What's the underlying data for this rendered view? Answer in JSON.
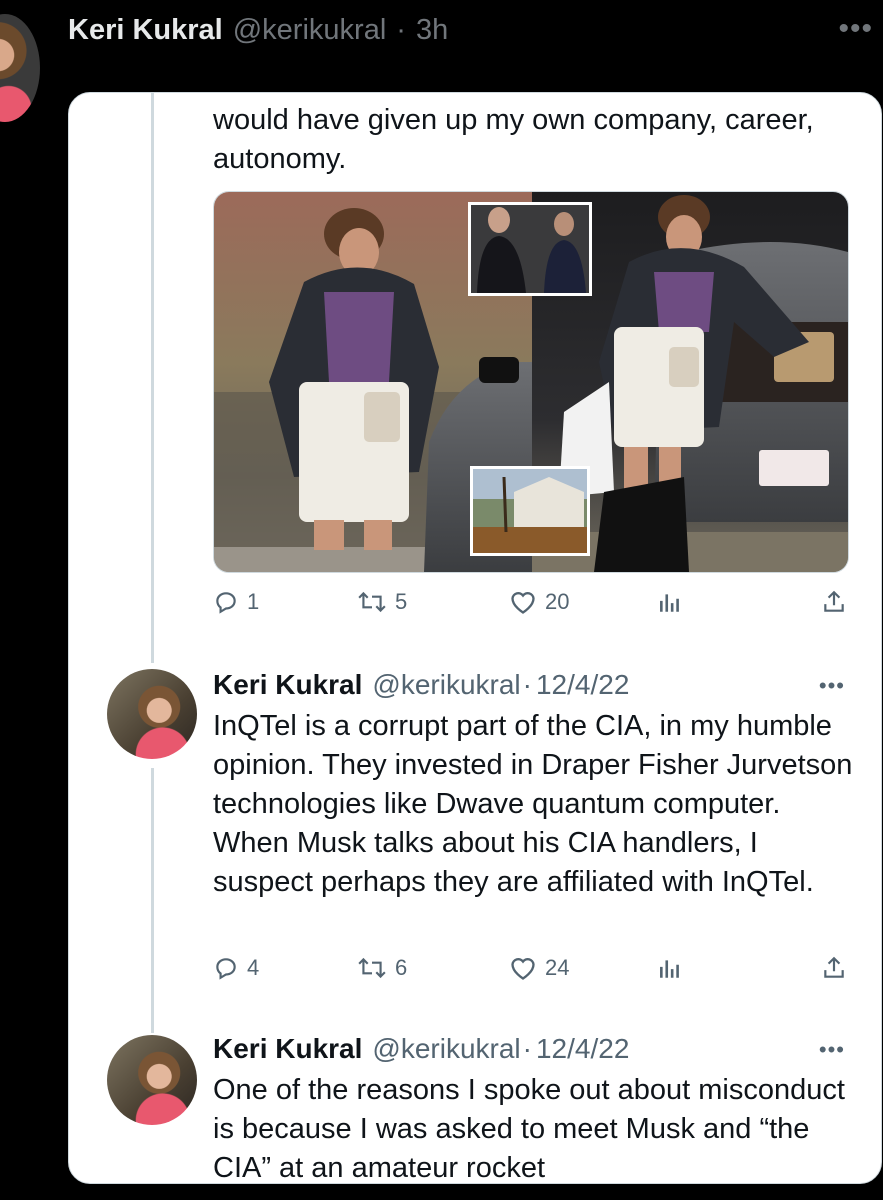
{
  "outer_tweet": {
    "display_name": "Keri Kukral",
    "handle": "@kerikukral",
    "separator": "·",
    "time": "3h",
    "more_label": "•••"
  },
  "quoted_thread": {
    "first_tweet": {
      "text_partial": "would have given up my own company, career, autonomy.",
      "actions": {
        "replies": "1",
        "retweets": "5",
        "likes": "20"
      }
    },
    "replies": [
      {
        "display_name": "Keri Kukral",
        "handle": "@kerikukral",
        "separator": "·",
        "date": "12/4/22",
        "more_label": "•••",
        "text": "InQTel is a corrupt part of the CIA, in my humble opinion. They invested in Draper Fisher Jurvetson technologies like Dwave quantum computer. When Musk talks about his CIA handlers, I suspect perhaps they are affiliated with InQTel.",
        "actions": {
          "replies": "4",
          "retweets": "6",
          "likes": "24"
        }
      },
      {
        "display_name": "Keri Kukral",
        "handle": "@kerikukral",
        "separator": "·",
        "date": "12/4/22",
        "more_label": "•••",
        "text": "One of the reasons I spoke out about misconduct is because I was asked to meet Musk and “the CIA” at an amateur rocket"
      }
    ]
  },
  "icons": {
    "reply": "reply-icon",
    "retweet": "retweet-icon",
    "like": "heart-icon",
    "views": "views-icon",
    "share": "share-icon"
  },
  "colors": {
    "background": "#000000",
    "card": "#ffffff",
    "secondary_text": "#536471",
    "primary_text": "#0f1419"
  }
}
